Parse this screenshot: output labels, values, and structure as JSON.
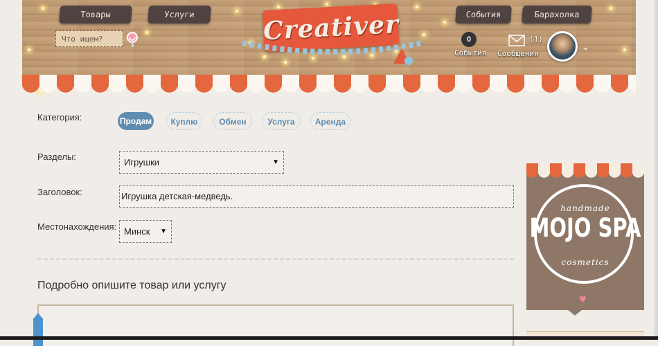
{
  "header": {
    "logo_text": "Creativer",
    "nav_left": [
      "Товары",
      "Услуги"
    ],
    "nav_right": [
      "События",
      "Барахолка"
    ],
    "search_placeholder": "Что ищем?",
    "events_count": "0",
    "events_label": "События",
    "messages_count": "(1)",
    "messages_label": "Сообщения"
  },
  "form": {
    "category_label": "Категория:",
    "categories": [
      "Продам",
      "Куплю",
      "Обмен",
      "Услуга",
      "Аренда"
    ],
    "active_category": "Продам",
    "sections_label": "Разделы:",
    "sections_value": "Игрушки",
    "title_label": "Заголовок:",
    "title_value": "Игрушка детская-медведь.",
    "location_label": "Местонахождения:",
    "location_value": "Минск",
    "description_heading": "Подробно опишите товар или услугу"
  },
  "ad": {
    "top_text": "handmade",
    "main_text": "MOJO SPA",
    "bottom_text": "cosmetics"
  },
  "colors": {
    "accent_blue": "#5f8db1",
    "awning_orange": "#e4673e",
    "logo_red": "#e5583b",
    "sign_dark": "#4e4340"
  }
}
